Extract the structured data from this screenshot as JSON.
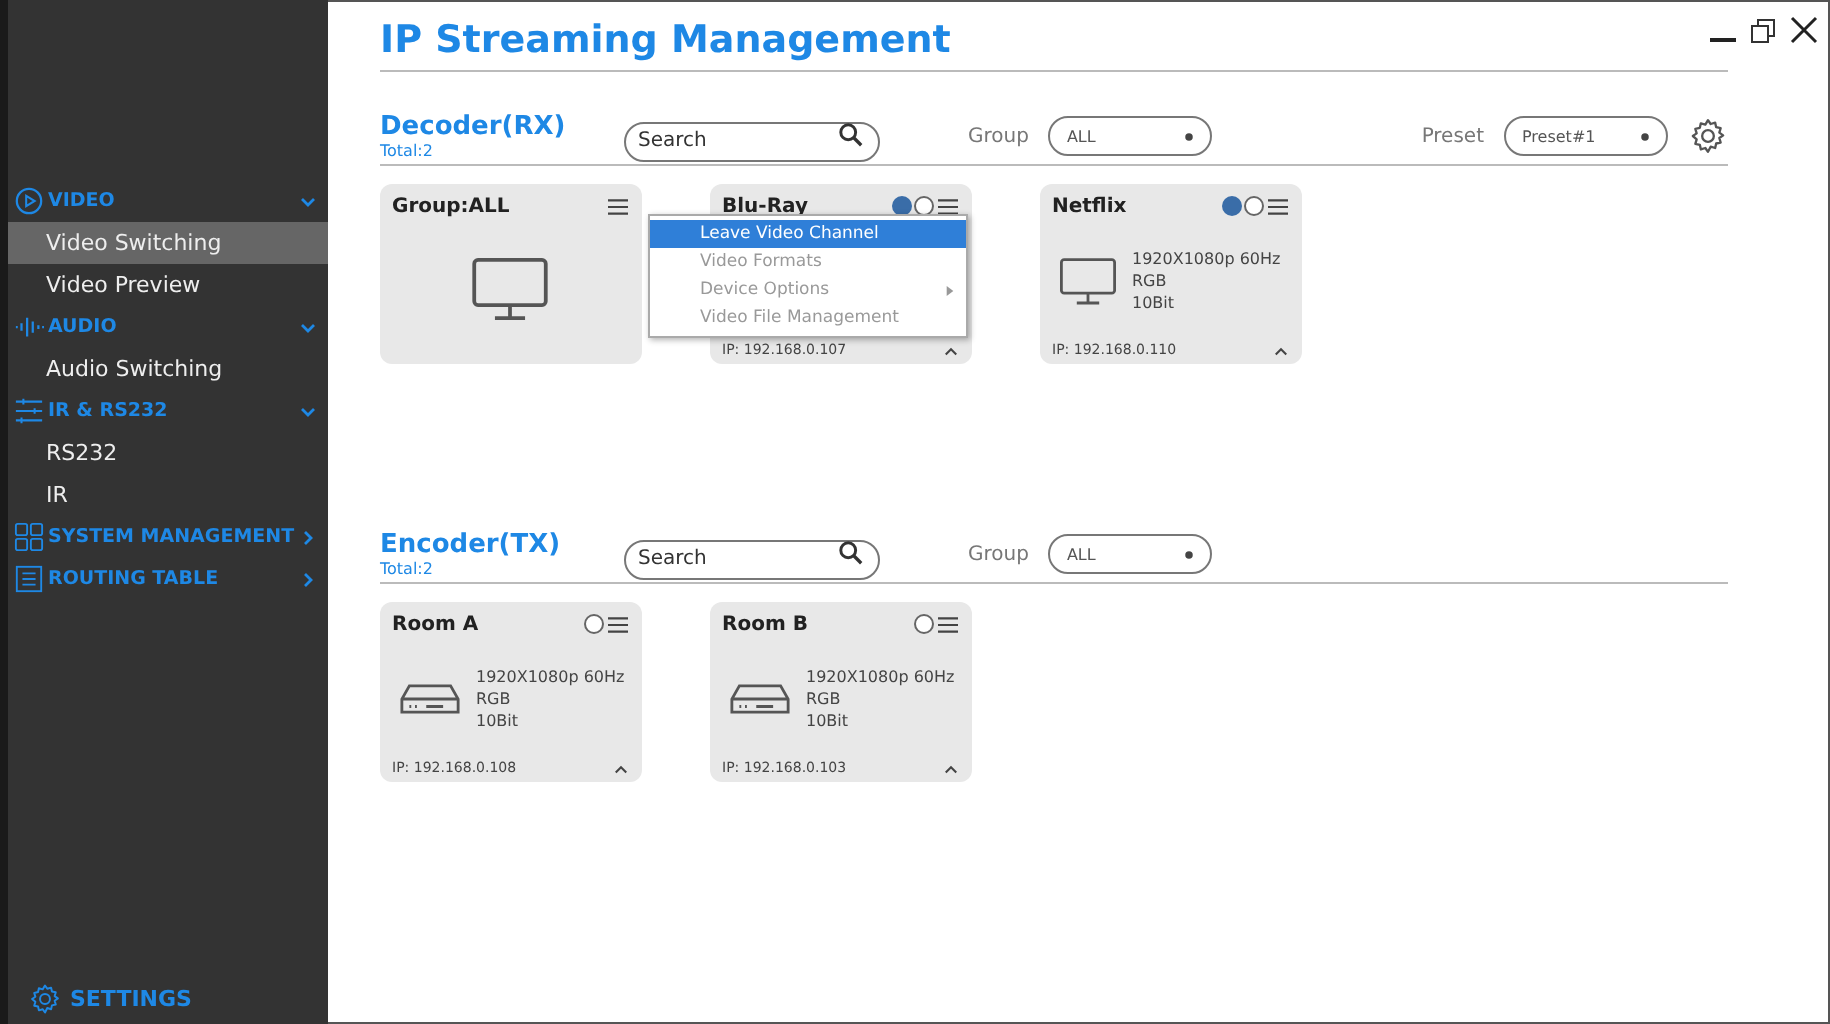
{
  "sidebar": {
    "groups": [
      {
        "kind": "video",
        "label": "VIDEO",
        "expanded": true,
        "items": [
          {
            "label": "Video Switching",
            "selected": true
          },
          {
            "label": "Video Preview",
            "selected": false
          }
        ]
      },
      {
        "kind": "audio",
        "label": "AUDIO",
        "expanded": true,
        "items": [
          {
            "label": "Audio Switching",
            "selected": false
          }
        ]
      },
      {
        "kind": "ir",
        "label": "IR & RS232",
        "expanded": true,
        "items": [
          {
            "label": "RS232",
            "selected": false
          },
          {
            "label": "IR",
            "selected": false
          }
        ]
      },
      {
        "kind": "system",
        "label": "SYSTEM MANAGEMENT",
        "expanded": false
      },
      {
        "kind": "routing",
        "label": "ROUTING TABLE",
        "expanded": false
      }
    ],
    "settings": "SETTINGS"
  },
  "window": {
    "title": "IP Streaming Management"
  },
  "sections": [
    {
      "kind": "decoder",
      "title": "Decoder(RX)",
      "total": "Total:2",
      "search_placeholder": "Search",
      "group_label": "Group",
      "group_value": "ALL",
      "preset_label": "Preset",
      "preset_value": "Preset#1",
      "cards": [
        {
          "kind": "group",
          "title": "Group:ALL"
        },
        {
          "kind": "device",
          "title": "Blu-Ray",
          "on": true,
          "ip": "IP: 192.168.0.107"
        },
        {
          "kind": "device",
          "title": "Netflix",
          "on": true,
          "details": [
            "1920X1080p 60Hz",
            "RGB",
            "10Bit"
          ],
          "ip": "IP: 192.168.0.110"
        }
      ],
      "menu": {
        "items": [
          {
            "label": "Leave Video Channel",
            "selected": true,
            "submenu": false
          },
          {
            "label": "Video Formats",
            "selected": false,
            "submenu": false
          },
          {
            "label": "Device Options",
            "selected": false,
            "submenu": true
          },
          {
            "label": "Video File Management",
            "selected": false,
            "submenu": false
          }
        ]
      }
    },
    {
      "kind": "encoder",
      "title": "Encoder(TX)",
      "total": "Total:2",
      "search_placeholder": "Search",
      "group_label": "Group",
      "group_value": "ALL",
      "cards": [
        {
          "kind": "device",
          "title": "Room A",
          "on": false,
          "details": [
            "1920X1080p 60Hz",
            "RGB",
            "10Bit"
          ],
          "ip": "IP: 192.168.0.108"
        },
        {
          "kind": "device",
          "title": "Room B",
          "on": false,
          "details": [
            "1920X1080p 60Hz",
            "RGB",
            "10Bit"
          ],
          "ip": "IP: 192.168.0.103"
        }
      ]
    }
  ]
}
